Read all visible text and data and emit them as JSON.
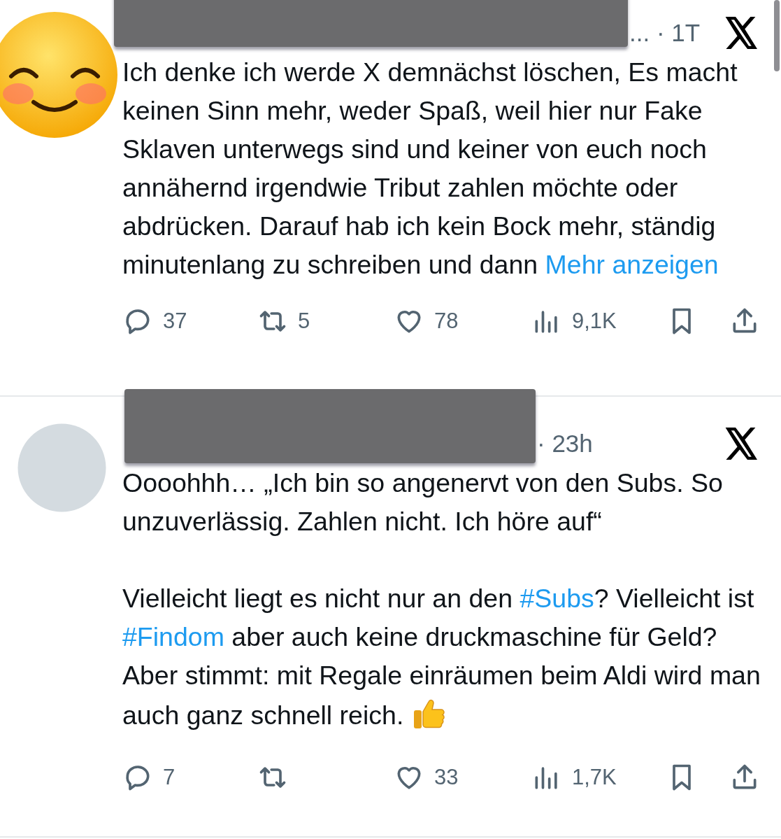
{
  "tweets": [
    {
      "avatar": {
        "kind": "emoji"
      },
      "redacted": true,
      "name_fragment": "...",
      "time": "· 1T",
      "paragraphs": [
        [
          {
            "kind": "text",
            "text": "Ich denke ich werde X demnächst löschen, Es macht keinen Sinn mehr, weder Spaß, weil hier nur Fake Sklaven unterwegs sind und keiner von euch noch annähernd irgendwie Tribut zahlen möchte oder abdrücken. Darauf hab ich kein Bock mehr, ständig minutenlang zu schreiben und dann "
          },
          {
            "kind": "more",
            "text": "Mehr anzeigen"
          }
        ]
      ],
      "stats": {
        "replies": "37",
        "reposts": "5",
        "likes": "78",
        "views": "9,1K"
      }
    },
    {
      "avatar": {
        "kind": "blank"
      },
      "redacted": true,
      "time": "· 23h",
      "paragraphs": [
        [
          {
            "kind": "text",
            "text": "Oooohhh… „Ich bin so angenervt von den Subs. So unzuverlässig. Zahlen nicht. Ich höre auf“"
          }
        ],
        [
          {
            "kind": "text",
            "text": "Vielleicht liegt es nicht nur an den "
          },
          {
            "kind": "hashtag",
            "text": "#Subs"
          },
          {
            "kind": "text",
            "text": "? Vielleicht ist "
          },
          {
            "kind": "hashtag",
            "text": "#Findom"
          },
          {
            "kind": "text",
            "text": " aber auch keine druckmaschine für Geld? Aber stimmt: mit Regale einräumen beim Aldi wird man auch ganz schnell reich. "
          },
          {
            "kind": "thumbs_emoji"
          }
        ]
      ],
      "stats": {
        "replies": "7",
        "likes": "33",
        "views": "1,7K"
      }
    }
  ]
}
